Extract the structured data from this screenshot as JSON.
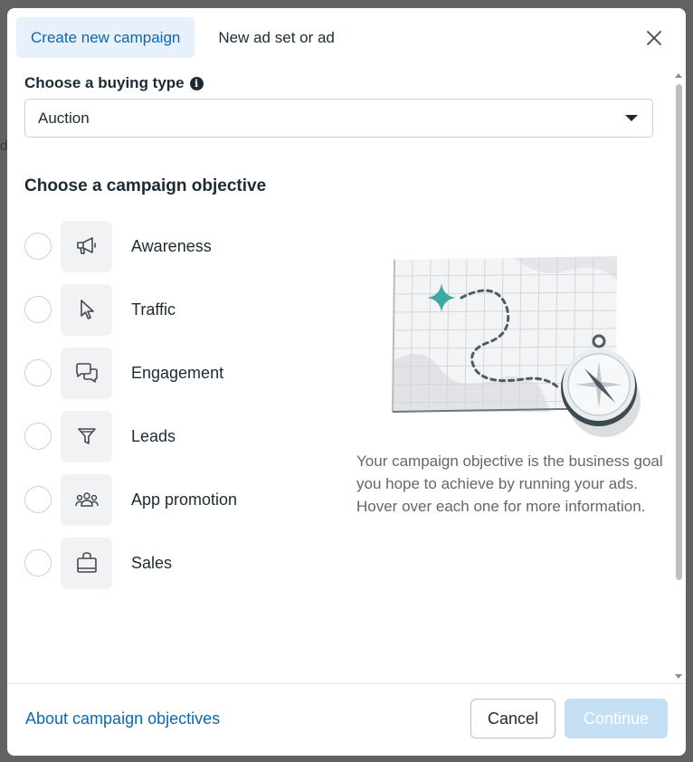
{
  "tabs": [
    {
      "label": "Create new campaign",
      "active": true
    },
    {
      "label": "New ad set or ad",
      "active": false
    }
  ],
  "buying_type": {
    "label": "Choose a buying type",
    "info_icon": "info-icon",
    "selected": "Auction"
  },
  "objective_section": {
    "title": "Choose a campaign objective",
    "items": [
      {
        "label": "Awareness",
        "icon": "megaphone-icon"
      },
      {
        "label": "Traffic",
        "icon": "cursor-icon"
      },
      {
        "label": "Engagement",
        "icon": "chat-bubbles-icon"
      },
      {
        "label": "Leads",
        "icon": "funnel-icon"
      },
      {
        "label": "App promotion",
        "icon": "people-icon"
      },
      {
        "label": "Sales",
        "icon": "shopping-bag-icon"
      }
    ],
    "description": "Your campaign objective is the business goal you hope to achieve by running your ads. Hover over each one for more information."
  },
  "footer": {
    "link": "About campaign objectives",
    "cancel": "Cancel",
    "continue": "Continue"
  },
  "colors": {
    "accent": "#0a68b6",
    "tab_active_bg": "#e6f1fb",
    "continue_disabled": "#c5dff5",
    "overlay": "#5f6062"
  }
}
